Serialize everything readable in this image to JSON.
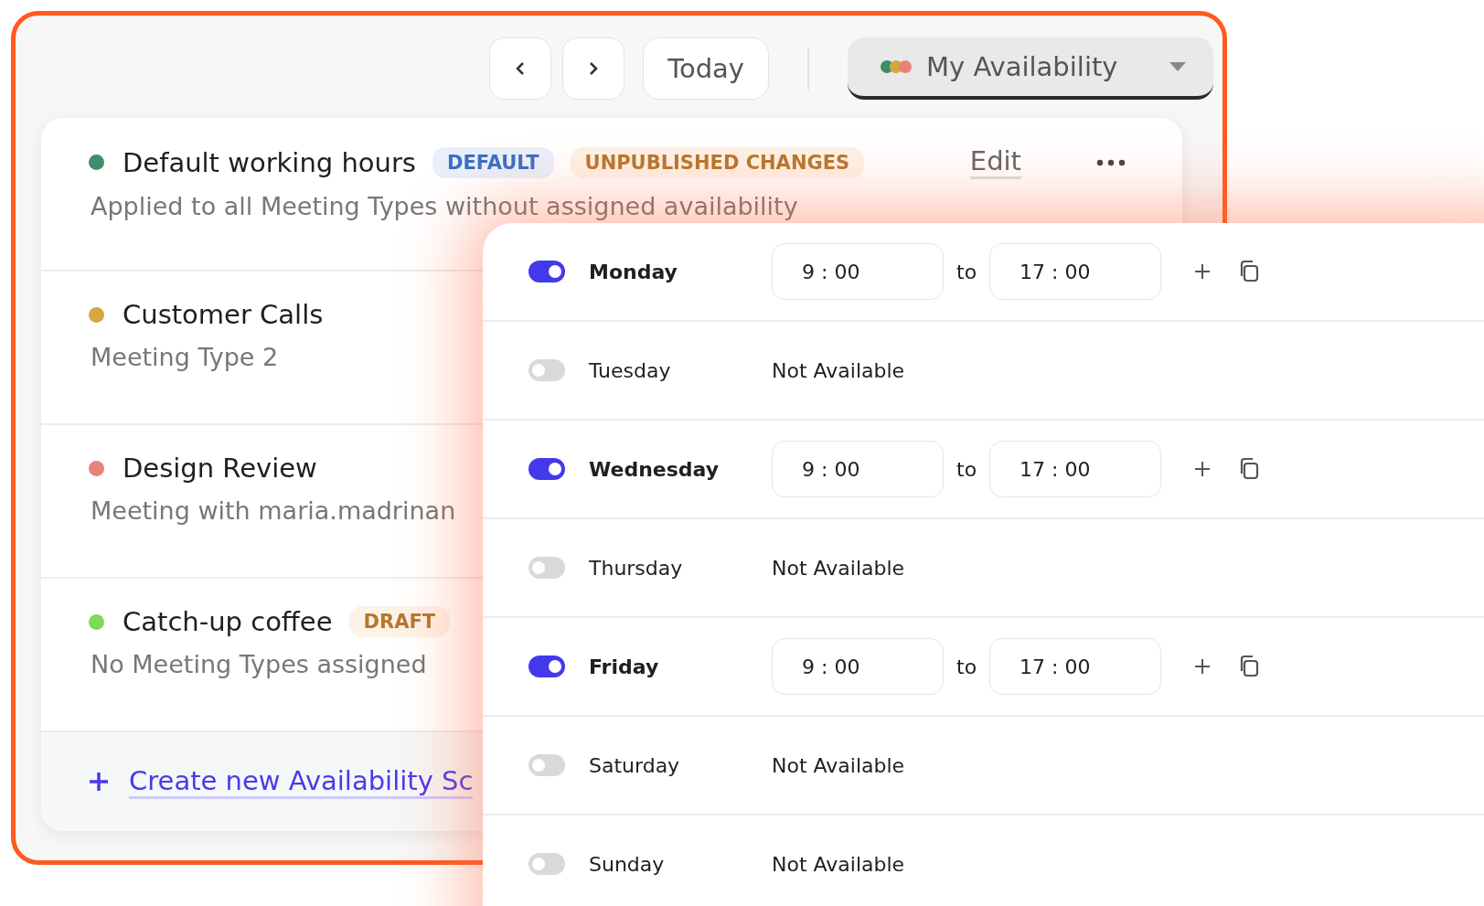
{
  "toolbar": {
    "today": "Today",
    "calendar_selector": "My Availability"
  },
  "schedules": [
    {
      "name": "Default working hours",
      "color": "#3e8e6a",
      "description": "Applied to all Meeting Types without assigned availability",
      "badges": [
        {
          "label": "DEFAULT",
          "kind": "info"
        },
        {
          "label": "UNPUBLISHED CHANGES",
          "kind": "warning"
        }
      ],
      "action": "Edit"
    },
    {
      "name": "Customer Calls",
      "color": "#d4a73f",
      "description": "Meeting Type 2"
    },
    {
      "name": "Design Review",
      "color": "#e8837a",
      "description": "Meeting with maria.madrinan"
    },
    {
      "name": "Catch-up coffee",
      "color": "#7ed957",
      "description": "No Meeting Types assigned",
      "badges": [
        {
          "label": "DRAFT",
          "kind": "warning"
        }
      ]
    }
  ],
  "create_link": "Create new Availability Sc",
  "days": [
    {
      "name": "Monday",
      "on": true,
      "from": "9 : 00",
      "to_label": "to",
      "to": "17 : 00"
    },
    {
      "name": "Tuesday",
      "on": false,
      "status": "Not Available"
    },
    {
      "name": "Wednesday",
      "on": true,
      "from": "9 : 00",
      "to_label": "to",
      "to": "17 : 00"
    },
    {
      "name": "Thursday",
      "on": false,
      "status": "Not Available"
    },
    {
      "name": "Friday",
      "on": true,
      "from": "9 : 00",
      "to_label": "to",
      "to": "17 : 00"
    },
    {
      "name": "Saturday",
      "on": false,
      "status": "Not Available"
    },
    {
      "name": "Sunday",
      "on": false,
      "status": "Not Available"
    }
  ]
}
